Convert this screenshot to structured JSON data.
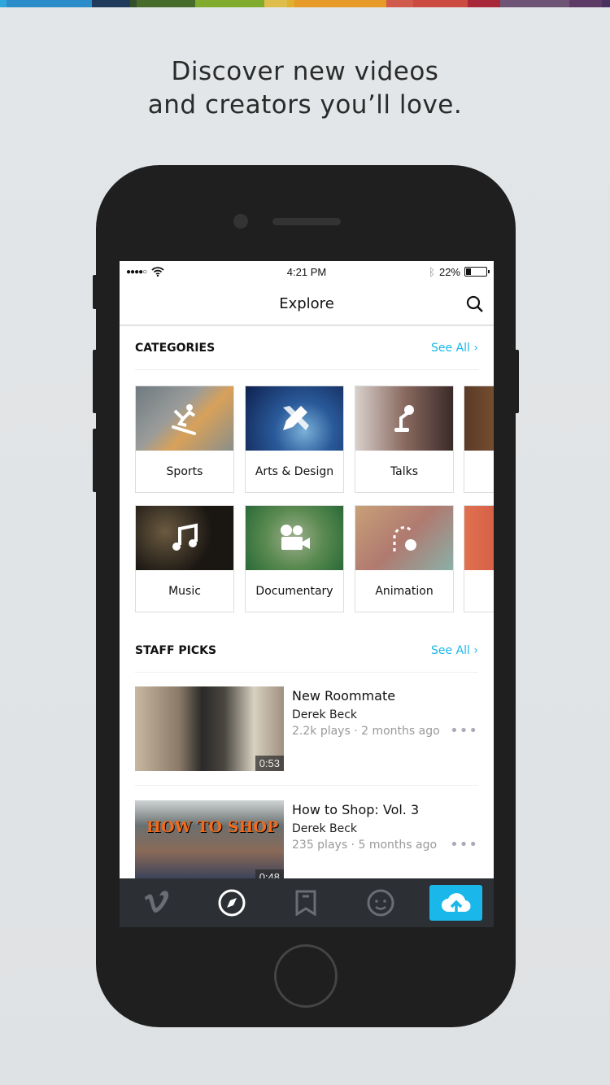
{
  "colors": {
    "accent": "#1ab7ea",
    "tabbar": "#2c2f33",
    "phone": "#1f1f1f"
  },
  "headline": {
    "line1": "Discover new videos",
    "line2": "and creators you’ll love."
  },
  "status": {
    "signal": "●●●●○",
    "time": "4:21 PM",
    "battery": "22%"
  },
  "nav": {
    "title": "Explore",
    "search_icon": "search-icon"
  },
  "categories": {
    "title": "CATEGORIES",
    "see_all": "See All ›",
    "items": [
      {
        "label": "Sports",
        "icon": "snowboard-icon"
      },
      {
        "label": "Arts & Design",
        "icon": "pencil-ruler-icon"
      },
      {
        "label": "Talks",
        "icon": "microphone-stand-icon"
      },
      {
        "label": "Music",
        "icon": "music-note-icon"
      },
      {
        "label": "Documentary",
        "icon": "film-camera-icon"
      },
      {
        "label": "Animation",
        "icon": "animation-path-icon"
      }
    ]
  },
  "staff_picks": {
    "title": "STAFF PICKS",
    "see_all": "See All ›",
    "videos": [
      {
        "title": "New Roommate",
        "author": "Derek Beck",
        "meta": "2.2k plays · 2 months ago",
        "duration": "0:53"
      },
      {
        "title": "How to Shop: Vol. 3",
        "author": "Derek Beck",
        "meta": "235 plays · 5 months ago",
        "duration": "0:48",
        "thumb_text": "HOW TO SHOP"
      }
    ]
  },
  "tabs": [
    {
      "icon": "vimeo-icon"
    },
    {
      "icon": "compass-icon",
      "active": true
    },
    {
      "icon": "bookmark-icon"
    },
    {
      "icon": "smiley-icon"
    },
    {
      "icon": "upload-cloud-icon"
    }
  ]
}
